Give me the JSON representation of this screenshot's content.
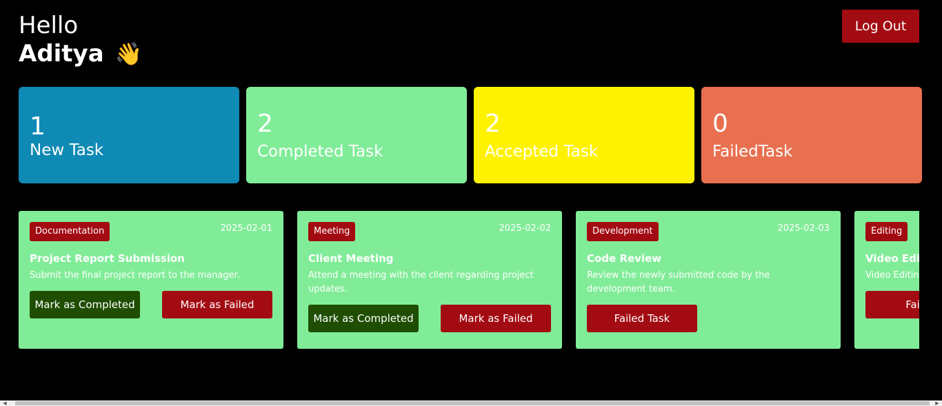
{
  "colors": {
    "background": "#000000",
    "accent_red": "#a30b12",
    "new_task": "#0f8ab4",
    "completed_task": "#81ec98",
    "accepted_task": "#fff200",
    "failed_task": "#e87050",
    "task_card": "#81ec98",
    "complete_button": "#1f4e03"
  },
  "header": {
    "greeting": "Hello",
    "username": "Aditya",
    "wave_icon": "👋",
    "logout_label": "Log Out"
  },
  "stats": [
    {
      "count": "1",
      "label": "New Task",
      "color": "#0f8ab4"
    },
    {
      "count": "2",
      "label": "Completed Task",
      "color": "#81ec98"
    },
    {
      "count": "2",
      "label": "Accepted Task",
      "color": "#fff200"
    },
    {
      "count": "0",
      "label": "FailedTask",
      "color": "#e87050"
    }
  ],
  "tasks": [
    {
      "category": "Documentation",
      "date": "2025-02-01",
      "title": "Project Report Submission",
      "description": "Submit the final project report to the manager.",
      "complete_label": "Mark as Completed",
      "fail_label": "Mark as Failed"
    },
    {
      "category": "Meeting",
      "date": "2025-02-02",
      "title": "Client Meeting",
      "description": "Attend a meeting with the client regarding project updates.",
      "complete_label": "Mark as Completed",
      "fail_label": "Mark as Failed"
    },
    {
      "category": "Development",
      "date": "2025-02-03",
      "title": "Code Review",
      "description": "Review the newly submitted code by the development team.",
      "failed_label": "Failed Task"
    },
    {
      "category": "Editing",
      "title": "Video Edit",
      "description": "Video Editing",
      "failed_label": "Failed"
    }
  ],
  "scrollbar": {
    "left_arrow_icon": "◀",
    "right_arrow_icon": "▶"
  }
}
